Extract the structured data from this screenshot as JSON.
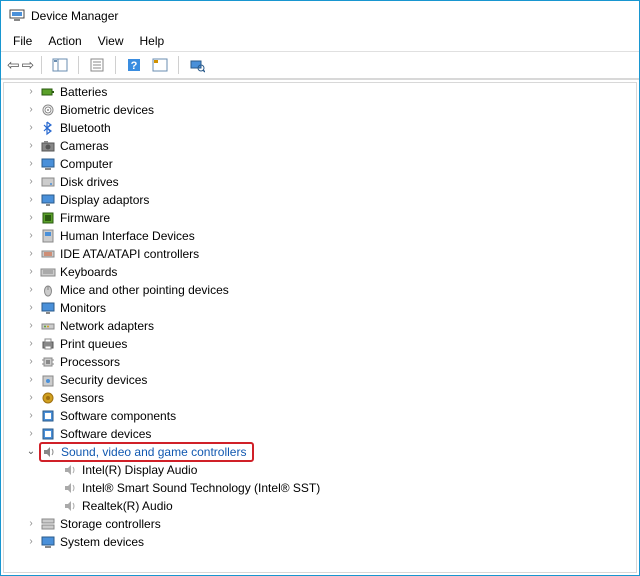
{
  "title": "Device Manager",
  "menu": {
    "file": "File",
    "action": "Action",
    "view": "View",
    "help": "Help"
  },
  "tree": [
    {
      "label": "Batteries",
      "icon": "battery"
    },
    {
      "label": "Biometric devices",
      "icon": "fingerprint"
    },
    {
      "label": "Bluetooth",
      "icon": "bluetooth"
    },
    {
      "label": "Cameras",
      "icon": "camera"
    },
    {
      "label": "Computer",
      "icon": "computer"
    },
    {
      "label": "Disk drives",
      "icon": "disk"
    },
    {
      "label": "Display adaptors",
      "icon": "display"
    },
    {
      "label": "Firmware",
      "icon": "firmware"
    },
    {
      "label": "Human Interface Devices",
      "icon": "hid"
    },
    {
      "label": "IDE ATA/ATAPI controllers",
      "icon": "ide"
    },
    {
      "label": "Keyboards",
      "icon": "keyboard"
    },
    {
      "label": "Mice and other pointing devices",
      "icon": "mouse"
    },
    {
      "label": "Monitors",
      "icon": "monitor"
    },
    {
      "label": "Network adapters",
      "icon": "network"
    },
    {
      "label": "Print queues",
      "icon": "printer"
    },
    {
      "label": "Processors",
      "icon": "cpu"
    },
    {
      "label": "Security devices",
      "icon": "security"
    },
    {
      "label": "Sensors",
      "icon": "sensor"
    },
    {
      "label": "Software components",
      "icon": "software"
    },
    {
      "label": "Software devices",
      "icon": "software"
    },
    {
      "label": "Sound, video and game controllers",
      "icon": "sound",
      "expanded": true,
      "highlighted": true,
      "children": [
        {
          "label": "Intel(R) Display Audio",
          "icon": "speaker"
        },
        {
          "label": "Intel® Smart Sound Technology (Intel® SST)",
          "icon": "speaker"
        },
        {
          "label": "Realtek(R) Audio",
          "icon": "speaker"
        }
      ]
    },
    {
      "label": "Storage controllers",
      "icon": "storage"
    },
    {
      "label": "System devices",
      "icon": "system"
    }
  ]
}
